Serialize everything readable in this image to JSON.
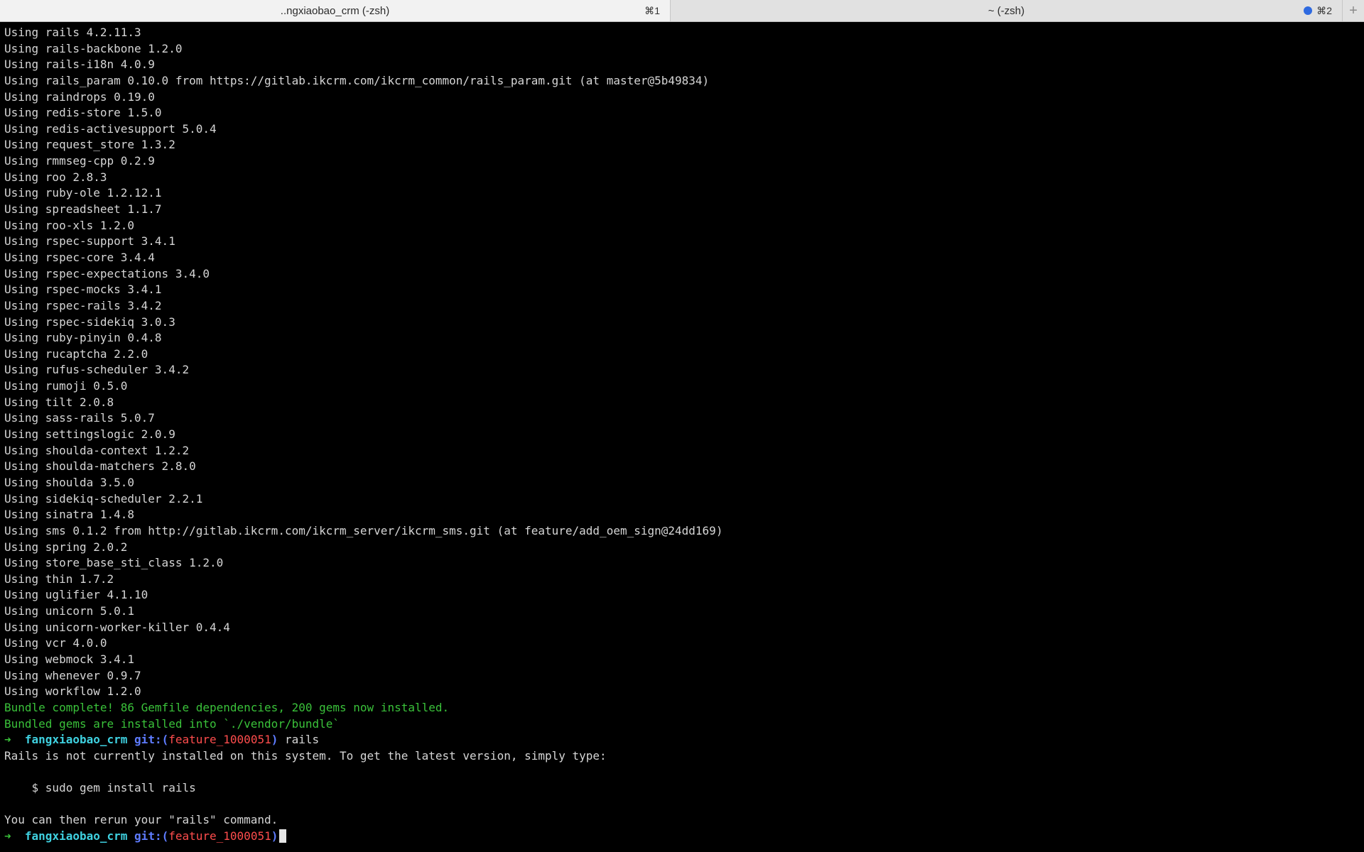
{
  "tabs": [
    {
      "title": "..ngxiaobao_crm (-zsh)",
      "shortcut": "⌘1"
    },
    {
      "title": "~ (-zsh)",
      "shortcut": "⌘2"
    }
  ],
  "new_tab_symbol": "+",
  "terminal": {
    "lines": [
      "Using rails 4.2.11.3",
      "Using rails-backbone 1.2.0",
      "Using rails-i18n 4.0.9",
      "Using rails_param 0.10.0 from https://gitlab.ikcrm.com/ikcrm_common/rails_param.git (at master@5b49834)",
      "Using raindrops 0.19.0",
      "Using redis-store 1.5.0",
      "Using redis-activesupport 5.0.4",
      "Using request_store 1.3.2",
      "Using rmmseg-cpp 0.2.9",
      "Using roo 2.8.3",
      "Using ruby-ole 1.2.12.1",
      "Using spreadsheet 1.1.7",
      "Using roo-xls 1.2.0",
      "Using rspec-support 3.4.1",
      "Using rspec-core 3.4.4",
      "Using rspec-expectations 3.4.0",
      "Using rspec-mocks 3.4.1",
      "Using rspec-rails 3.4.2",
      "Using rspec-sidekiq 3.0.3",
      "Using ruby-pinyin 0.4.8",
      "Using rucaptcha 2.2.0",
      "Using rufus-scheduler 3.4.2",
      "Using rumoji 0.5.0",
      "Using tilt 2.0.8",
      "Using sass-rails 5.0.7",
      "Using settingslogic 2.0.9",
      "Using shoulda-context 1.2.2",
      "Using shoulda-matchers 2.8.0",
      "Using shoulda 3.5.0",
      "Using sidekiq-scheduler 2.2.1",
      "Using sinatra 1.4.8",
      "Using sms 0.1.2 from http://gitlab.ikcrm.com/ikcrm_server/ikcrm_sms.git (at feature/add_oem_sign@24dd169)",
      "Using spring 2.0.2",
      "Using store_base_sti_class 1.2.0",
      "Using thin 1.7.2",
      "Using uglifier 4.1.10",
      "Using unicorn 5.0.1",
      "Using unicorn-worker-killer 0.4.4",
      "Using vcr 4.0.0",
      "Using webmock 3.4.1",
      "Using whenever 0.9.7",
      "Using workflow 1.2.0"
    ],
    "bundle_complete": "Bundle complete! 86 Gemfile dependencies, 200 gems now installed.",
    "bundled_into": "Bundled gems are installed into `./vendor/bundle`",
    "prompt": {
      "arrow": "➜",
      "dir": "fangxiaobao_crm",
      "git_label": "git:",
      "paren_open": "(",
      "branch": "feature_1000051",
      "paren_close": ")"
    },
    "command": "rails",
    "rails_message": "Rails is not currently installed on this system. To get the latest version, simply type:",
    "install_hint": "    $ sudo gem install rails",
    "rerun_message": "You can then rerun your \"rails\" command."
  },
  "colors": {
    "background": "#000000",
    "text": "#d6d6d6",
    "green": "#3ac23a",
    "cyan": "#3fd1e0",
    "blue": "#5e7cff",
    "red": "#ff4d4d",
    "tab_dot": "#2f6ae0"
  }
}
